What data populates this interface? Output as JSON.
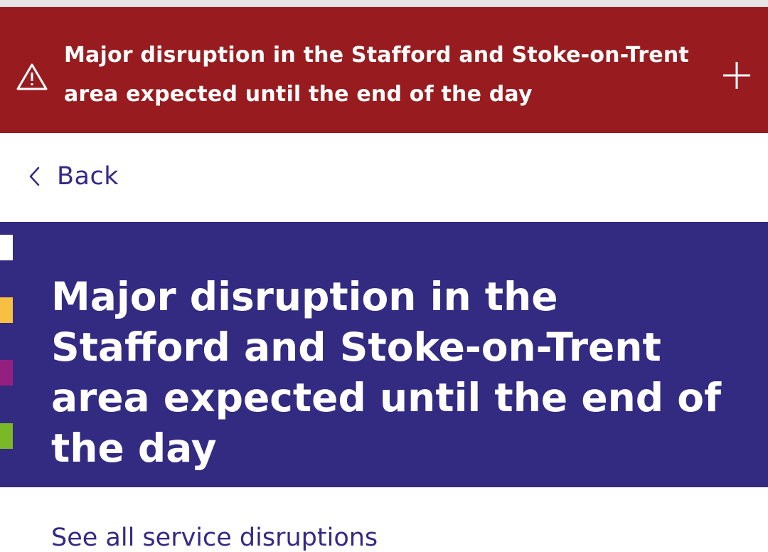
{
  "alert": {
    "text": "Major disruption in the Stafford and Stoke-on-Trent area expected until the end of the day",
    "icon": "warning-triangle-icon",
    "expand_icon": "plus-icon",
    "background_color": "#981c1f"
  },
  "nav": {
    "back_label": "Back",
    "back_icon": "chevron-left-icon",
    "link_color": "#332a86"
  },
  "hero": {
    "title": "Major disruption in the Stafford and Stoke-on-Trent area expected until the end of the day",
    "background_color": "#332a82",
    "stripe_colors": [
      "#ffffff",
      "#f8c042",
      "#941f80",
      "#7ab828"
    ]
  },
  "partial_link": {
    "text": "See all service disruptions"
  }
}
